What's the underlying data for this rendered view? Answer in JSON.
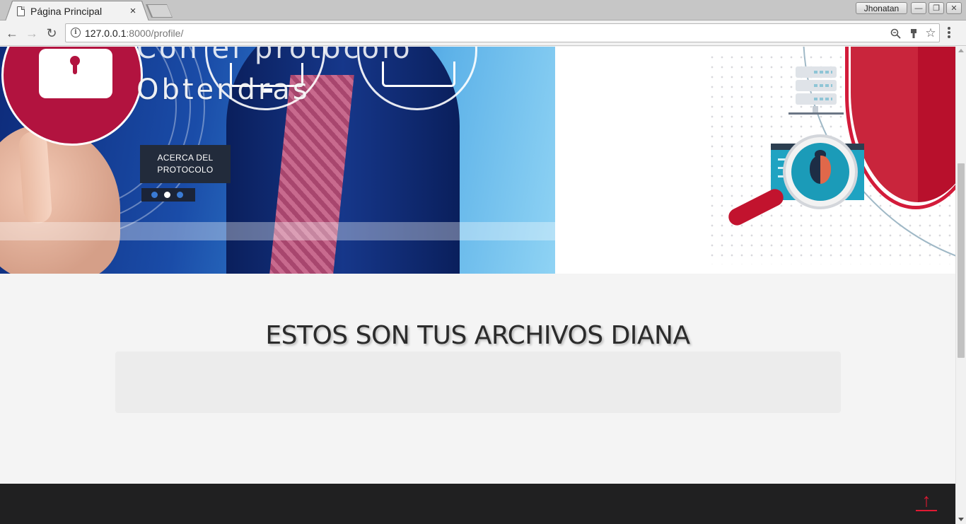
{
  "browser": {
    "tab_title": "Página Principal",
    "tab_close": "×",
    "profile_name": "Jhonatan",
    "url_host": "127.0.0.1",
    "url_rest": ":8000/profile/",
    "info_glyph": "i",
    "back_glyph": "←",
    "forward_glyph": "→",
    "reload_glyph": "↻",
    "zoom_icon": "zoom-icon",
    "extension_icon": "pin-extension-icon",
    "bookmark_glyph": "☆",
    "minimize_glyph": "—",
    "restore_glyph": "❐",
    "close_glyph": "✕"
  },
  "hero": {
    "headline_top": "Con el protocolo",
    "headline": "Obtendras",
    "button_label_line1": "ACERCA DEL",
    "button_label_line2": "PROTOCOLO",
    "slides": 3,
    "active_slide": 2
  },
  "main": {
    "title": "ESTOS SON TUS ARCHIVOS DIANA"
  },
  "footer": {
    "back_to_top_glyph": "↑"
  },
  "colors": {
    "accent_red": "#e01933",
    "button_bg": "#222b3b",
    "footer_bg": "#202021",
    "page_bg": "#f4f4f4"
  }
}
